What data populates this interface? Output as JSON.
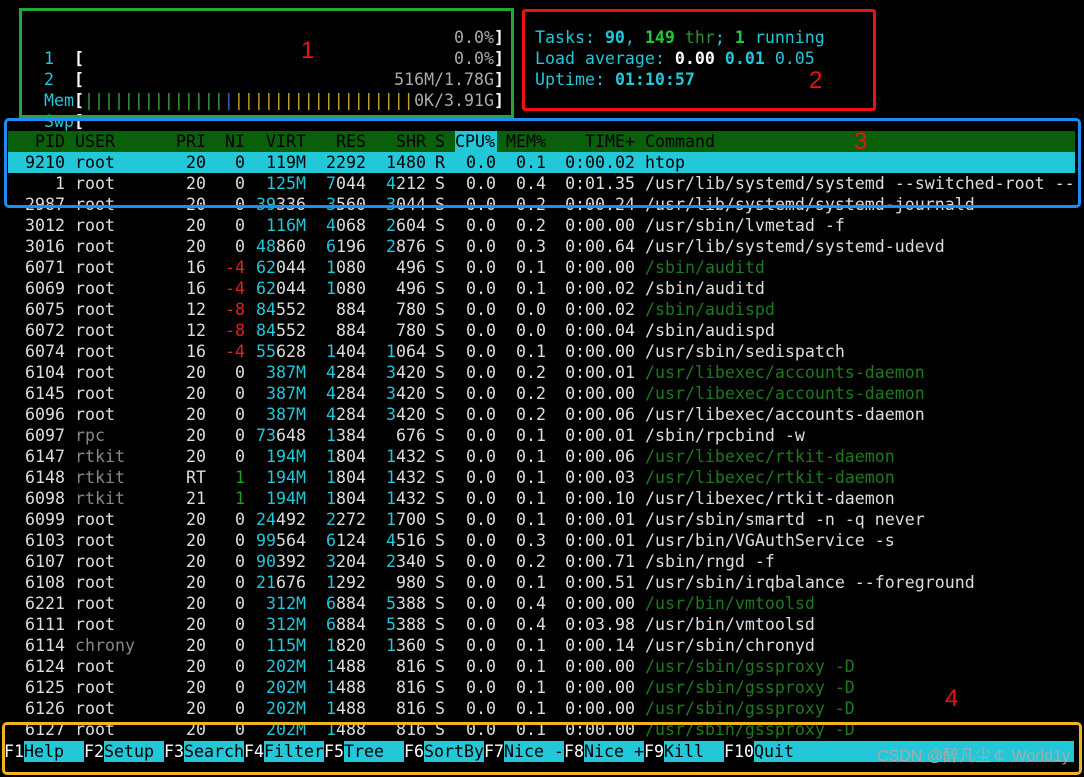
{
  "meters": {
    "cpu1": {
      "label": "1",
      "open": "[",
      "bar": "",
      "value": "0.0%",
      "close": "]"
    },
    "cpu2": {
      "label": "2",
      "open": "[",
      "bar": "",
      "value": "0.0%",
      "close": "]"
    },
    "mem": {
      "label": "Mem",
      "open": "[",
      "bar_green": "||||||||||||||",
      "bar_blue": "|",
      "bar_yellow": "||||||||||||||||||",
      "value": "516M/1.78G",
      "close": "]"
    },
    "swp": {
      "label": "Swp",
      "open": "[",
      "bar": "",
      "value": "0K/3.91G",
      "close": "]"
    }
  },
  "summary": {
    "tasks_label": "Tasks: ",
    "tasks": "90",
    "sep1": ", ",
    "threads": "149",
    "thr_label": " thr",
    "sep2": "; ",
    "running": "1",
    "running_label": " running",
    "load_label": "Load average: ",
    "load1": "0.00",
    "load5": "0.01",
    "load15": "0.05",
    "uptime_label": "Uptime: ",
    "uptime": "01:10:57"
  },
  "columns": {
    "pid": "PID",
    "user": "USER",
    "pri": "PRI",
    "ni": "NI",
    "virt": "VIRT",
    "res": "RES",
    "shr": "SHR",
    "s": "S",
    "cpu": "CPU%",
    "mem": "MEM%",
    "time": "TIME+",
    "command": "Command"
  },
  "processes": [
    {
      "pid": "9210",
      "user": "root",
      "pri": "20",
      "ni": "0",
      "virt": "119M",
      "res": "2292",
      "shr": "1480",
      "s": "R",
      "cpu": "0.0",
      "mem": "0.1",
      "time": "0:00.02",
      "command": "htop"
    },
    {
      "pid": "1",
      "user": "root",
      "pri": "20",
      "ni": "0",
      "virt": "125M",
      "res": "7044",
      "shr": "4212",
      "s": "S",
      "cpu": "0.0",
      "mem": "0.4",
      "time": "0:01.35",
      "command": "/usr/lib/systemd/systemd --switched-root --"
    },
    {
      "pid": "2987",
      "user": "root",
      "pri": "20",
      "ni": "0",
      "virt": "39336",
      "res": "3560",
      "shr": "3044",
      "s": "S",
      "cpu": "0.0",
      "mem": "0.2",
      "time": "0:00.24",
      "command": "/usr/lib/systemd/systemd-journald"
    },
    {
      "pid": "3012",
      "user": "root",
      "pri": "20",
      "ni": "0",
      "virt": "116M",
      "res": "4068",
      "shr": "2604",
      "s": "S",
      "cpu": "0.0",
      "mem": "0.2",
      "time": "0:00.00",
      "command": "/usr/sbin/lvmetad -f"
    },
    {
      "pid": "3016",
      "user": "root",
      "pri": "20",
      "ni": "0",
      "virt": "48860",
      "res": "6196",
      "shr": "2876",
      "s": "S",
      "cpu": "0.0",
      "mem": "0.3",
      "time": "0:00.64",
      "command": "/usr/lib/systemd/systemd-udevd"
    },
    {
      "pid": "6071",
      "user": "root",
      "pri": "16",
      "ni": "-4",
      "virt": "62044",
      "res": "1080",
      "shr": "496",
      "s": "S",
      "cpu": "0.0",
      "mem": "0.1",
      "time": "0:00.00",
      "command": "/sbin/auditd"
    },
    {
      "pid": "6069",
      "user": "root",
      "pri": "16",
      "ni": "-4",
      "virt": "62044",
      "res": "1080",
      "shr": "496",
      "s": "S",
      "cpu": "0.0",
      "mem": "0.1",
      "time": "0:00.02",
      "command": "/sbin/auditd"
    },
    {
      "pid": "6075",
      "user": "root",
      "pri": "12",
      "ni": "-8",
      "virt": "84552",
      "res": "884",
      "shr": "780",
      "s": "S",
      "cpu": "0.0",
      "mem": "0.0",
      "time": "0:00.02",
      "command": "/sbin/audispd"
    },
    {
      "pid": "6072",
      "user": "root",
      "pri": "12",
      "ni": "-8",
      "virt": "84552",
      "res": "884",
      "shr": "780",
      "s": "S",
      "cpu": "0.0",
      "mem": "0.0",
      "time": "0:00.04",
      "command": "/sbin/audispd"
    },
    {
      "pid": "6074",
      "user": "root",
      "pri": "16",
      "ni": "-4",
      "virt": "55628",
      "res": "1404",
      "shr": "1064",
      "s": "S",
      "cpu": "0.0",
      "mem": "0.1",
      "time": "0:00.00",
      "command": "/usr/sbin/sedispatch"
    },
    {
      "pid": "6104",
      "user": "root",
      "pri": "20",
      "ni": "0",
      "virt": "387M",
      "res": "4284",
      "shr": "3420",
      "s": "S",
      "cpu": "0.0",
      "mem": "0.2",
      "time": "0:00.01",
      "command": "/usr/libexec/accounts-daemon"
    },
    {
      "pid": "6145",
      "user": "root",
      "pri": "20",
      "ni": "0",
      "virt": "387M",
      "res": "4284",
      "shr": "3420",
      "s": "S",
      "cpu": "0.0",
      "mem": "0.2",
      "time": "0:00.00",
      "command": "/usr/libexec/accounts-daemon"
    },
    {
      "pid": "6096",
      "user": "root",
      "pri": "20",
      "ni": "0",
      "virt": "387M",
      "res": "4284",
      "shr": "3420",
      "s": "S",
      "cpu": "0.0",
      "mem": "0.2",
      "time": "0:00.06",
      "command": "/usr/libexec/accounts-daemon"
    },
    {
      "pid": "6097",
      "user": "rpc",
      "pri": "20",
      "ni": "0",
      "virt": "73648",
      "res": "1384",
      "shr": "676",
      "s": "S",
      "cpu": "0.0",
      "mem": "0.1",
      "time": "0:00.01",
      "command": "/sbin/rpcbind -w"
    },
    {
      "pid": "6147",
      "user": "rtkit",
      "pri": "20",
      "ni": "0",
      "virt": "194M",
      "res": "1804",
      "shr": "1432",
      "s": "S",
      "cpu": "0.0",
      "mem": "0.1",
      "time": "0:00.06",
      "command": "/usr/libexec/rtkit-daemon"
    },
    {
      "pid": "6148",
      "user": "rtkit",
      "pri": "RT",
      "ni": "1",
      "virt": "194M",
      "res": "1804",
      "shr": "1432",
      "s": "S",
      "cpu": "0.0",
      "mem": "0.1",
      "time": "0:00.03",
      "command": "/usr/libexec/rtkit-daemon"
    },
    {
      "pid": "6098",
      "user": "rtkit",
      "pri": "21",
      "ni": "1",
      "virt": "194M",
      "res": "1804",
      "shr": "1432",
      "s": "S",
      "cpu": "0.0",
      "mem": "0.1",
      "time": "0:00.10",
      "command": "/usr/libexec/rtkit-daemon"
    },
    {
      "pid": "6099",
      "user": "root",
      "pri": "20",
      "ni": "0",
      "virt": "24492",
      "res": "2272",
      "shr": "1700",
      "s": "S",
      "cpu": "0.0",
      "mem": "0.1",
      "time": "0:00.01",
      "command": "/usr/sbin/smartd -n -q never"
    },
    {
      "pid": "6103",
      "user": "root",
      "pri": "20",
      "ni": "0",
      "virt": "99564",
      "res": "6124",
      "shr": "4516",
      "s": "S",
      "cpu": "0.0",
      "mem": "0.3",
      "time": "0:00.01",
      "command": "/usr/bin/VGAuthService -s"
    },
    {
      "pid": "6107",
      "user": "root",
      "pri": "20",
      "ni": "0",
      "virt": "90392",
      "res": "3204",
      "shr": "2340",
      "s": "S",
      "cpu": "0.0",
      "mem": "0.2",
      "time": "0:00.71",
      "command": "/sbin/rngd -f"
    },
    {
      "pid": "6108",
      "user": "root",
      "pri": "20",
      "ni": "0",
      "virt": "21676",
      "res": "1292",
      "shr": "980",
      "s": "S",
      "cpu": "0.0",
      "mem": "0.1",
      "time": "0:00.51",
      "command": "/usr/sbin/irqbalance --foreground"
    },
    {
      "pid": "6221",
      "user": "root",
      "pri": "20",
      "ni": "0",
      "virt": "312M",
      "res": "6884",
      "shr": "5388",
      "s": "S",
      "cpu": "0.0",
      "mem": "0.4",
      "time": "0:00.00",
      "command": "/usr/bin/vmtoolsd"
    },
    {
      "pid": "6111",
      "user": "root",
      "pri": "20",
      "ni": "0",
      "virt": "312M",
      "res": "6884",
      "shr": "5388",
      "s": "S",
      "cpu": "0.0",
      "mem": "0.4",
      "time": "0:03.98",
      "command": "/usr/bin/vmtoolsd"
    },
    {
      "pid": "6114",
      "user": "chrony",
      "pri": "20",
      "ni": "0",
      "virt": "115M",
      "res": "1820",
      "shr": "1360",
      "s": "S",
      "cpu": "0.0",
      "mem": "0.1",
      "time": "0:00.14",
      "command": "/usr/sbin/chronyd"
    },
    {
      "pid": "6124",
      "user": "root",
      "pri": "20",
      "ni": "0",
      "virt": "202M",
      "res": "1488",
      "shr": "816",
      "s": "S",
      "cpu": "0.0",
      "mem": "0.1",
      "time": "0:00.00",
      "command": "/usr/sbin/gssproxy -D"
    },
    {
      "pid": "6125",
      "user": "root",
      "pri": "20",
      "ni": "0",
      "virt": "202M",
      "res": "1488",
      "shr": "816",
      "s": "S",
      "cpu": "0.0",
      "mem": "0.1",
      "time": "0:00.00",
      "command": "/usr/sbin/gssproxy -D"
    },
    {
      "pid": "6126",
      "user": "root",
      "pri": "20",
      "ni": "0",
      "virt": "202M",
      "res": "1488",
      "shr": "816",
      "s": "S",
      "cpu": "0.0",
      "mem": "0.1",
      "time": "0:00.00",
      "command": "/usr/sbin/gssproxy -D"
    },
    {
      "pid": "6127",
      "user": "root",
      "pri": "20",
      "ni": "0",
      "virt": "202M",
      "res": "1488",
      "shr": "816",
      "s": "S",
      "cpu": "0.0",
      "mem": "0.1",
      "time": "0:00.00",
      "command": "/usr/sbin/gssproxy -D"
    }
  ],
  "function_keys": [
    {
      "key": "F1",
      "label": "Help"
    },
    {
      "key": "F2",
      "label": "Setup"
    },
    {
      "key": "F3",
      "label": "Search"
    },
    {
      "key": "F4",
      "label": "Filter"
    },
    {
      "key": "F5",
      "label": "Tree"
    },
    {
      "key": "F6",
      "label": "SortBy"
    },
    {
      "key": "F7",
      "label": "Nice -"
    },
    {
      "key": "F8",
      "label": "Nice +"
    },
    {
      "key": "F9",
      "label": "Kill"
    },
    {
      "key": "F10",
      "label": "Quit"
    }
  ],
  "annotations": {
    "a1": "1",
    "a2": "2",
    "a3": "3",
    "a4": "4"
  },
  "watermark": "CSDN @醉凡尘￠ World1y",
  "colors": {
    "cyan": "#22c7d8",
    "header_green": "#0a5f0a",
    "box1": "#22a83a",
    "box2": "#e11",
    "box3": "#1e8cf0",
    "box4": "#f0b41e"
  }
}
